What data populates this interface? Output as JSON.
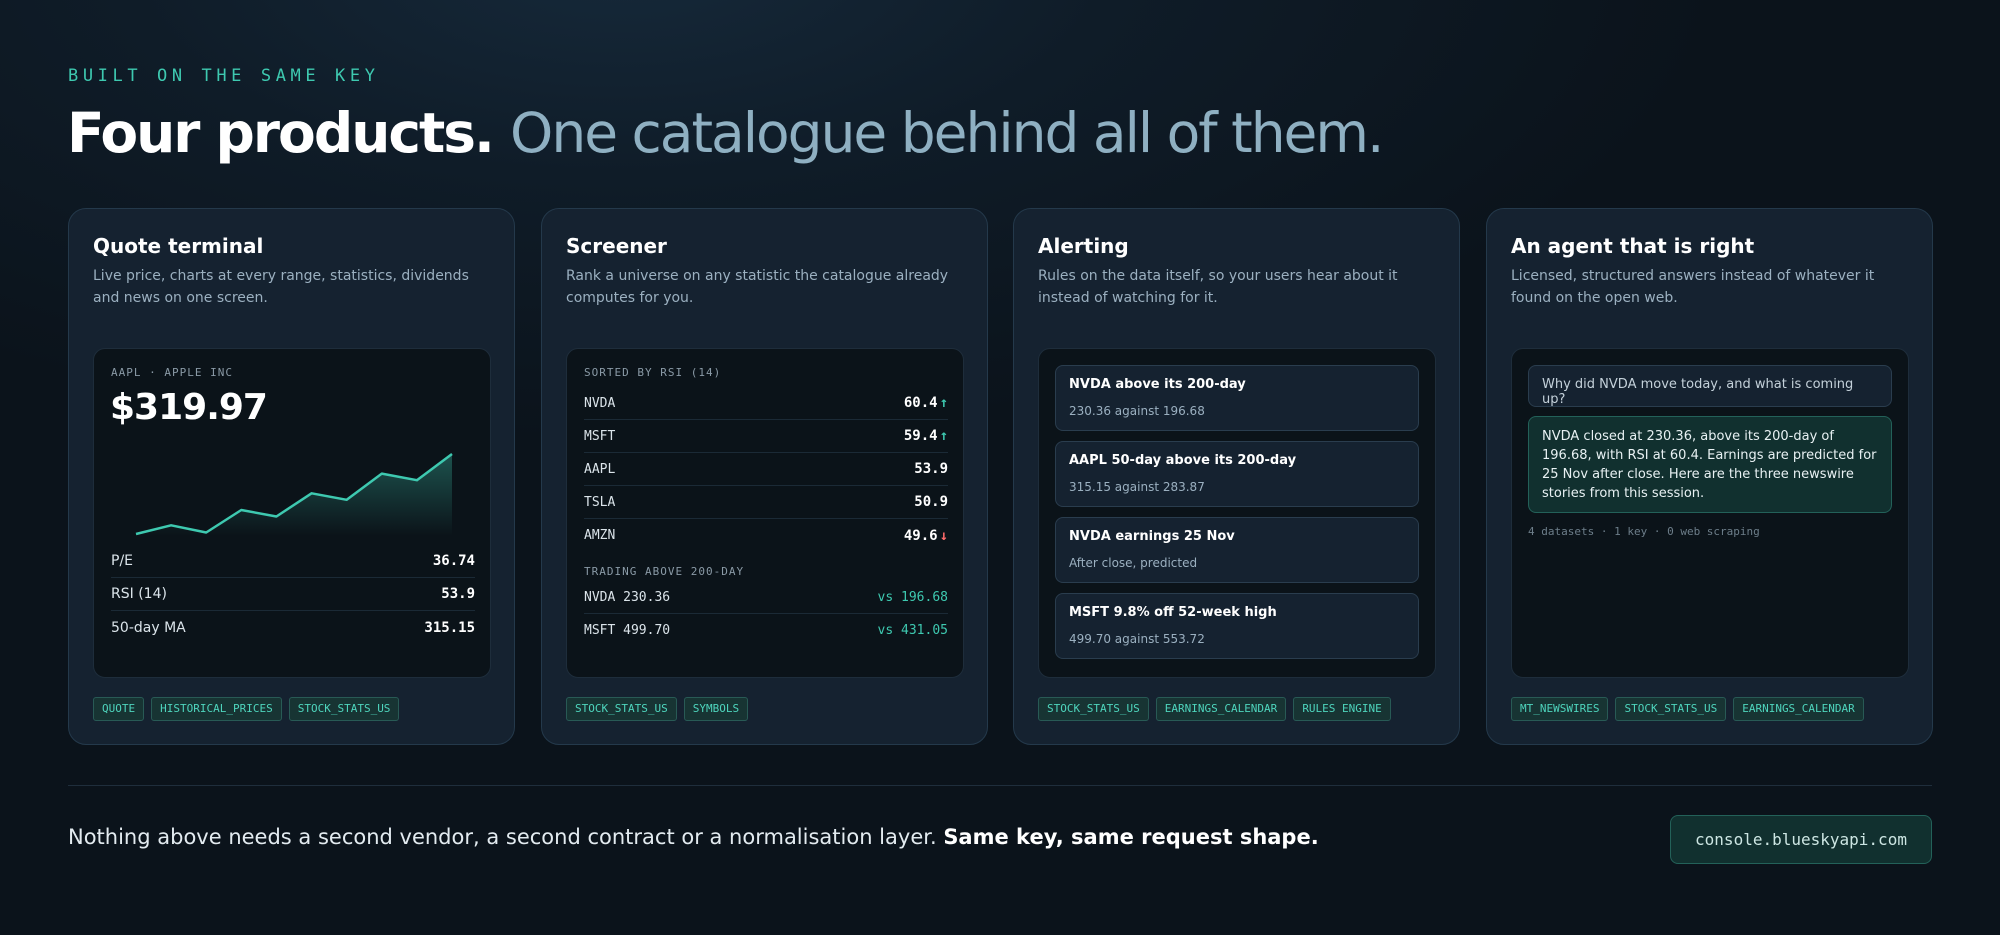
{
  "hero": {
    "eyebrow": "BUILT ON THE SAME KEY",
    "headline_strong": "Four products.",
    "headline_soft": "One catalogue behind all of them."
  },
  "colors": {
    "accent": "#3ec9b0",
    "negative": "#ff6b6b",
    "card_bg": "#152230",
    "page_bg": "#0b131b"
  },
  "cards": [
    {
      "title": "Quote terminal",
      "description": "Live price, charts at every range, statistics, dividends and news on one screen.",
      "tags": [
        "QUOTE",
        "HISTORICAL_PRICES",
        "STOCK_STATS_US"
      ]
    },
    {
      "title": "Screener",
      "description": "Rank a universe on any statistic the catalogue already computes for you.",
      "tags": [
        "STOCK_STATS_US",
        "SYMBOLS"
      ]
    },
    {
      "title": "Alerting",
      "description": "Rules on the data itself, so your users hear about it instead of watching for it.",
      "tags": [
        "STOCK_STATS_US",
        "EARNINGS_CALENDAR",
        "RULES ENGINE"
      ]
    },
    {
      "title": "An agent that is right",
      "description": "Licensed, structured answers instead of whatever it found on the open web.",
      "tags": [
        "MT_NEWSWIRES",
        "STOCK_STATS_US",
        "EARNINGS_CALENDAR"
      ]
    }
  ],
  "quote": {
    "symbol_line": "AAPL · APPLE INC",
    "price": "$319.97",
    "sparkline": [
      2,
      3.2,
      2.2,
      5.3,
      4.4,
      7.6,
      6.7,
      10.3,
      9.4,
      13
    ],
    "stats": [
      {
        "label": "P/E",
        "value": "36.74"
      },
      {
        "label": "RSI (14)",
        "value": "53.9"
      },
      {
        "label": "50-day MA",
        "value": "315.15"
      }
    ]
  },
  "screener": {
    "sort_heading": "SORTED BY RSI (14)",
    "rows": [
      {
        "symbol": "NVDA",
        "value": "60.4",
        "arrow": "↑"
      },
      {
        "symbol": "MSFT",
        "value": "59.4",
        "arrow": "↑"
      },
      {
        "symbol": "AAPL",
        "value": "53.9",
        "arrow": ""
      },
      {
        "symbol": "TSLA",
        "value": "50.9",
        "arrow": ""
      },
      {
        "symbol": "AMZN",
        "value": "49.6",
        "arrow": "↓"
      }
    ],
    "trend_heading": "TRADING ABOVE 200-DAY",
    "trend_rows": [
      {
        "left": "NVDA 230.36",
        "right": "vs 196.68"
      },
      {
        "left": "MSFT 499.70",
        "right": "vs 431.05"
      }
    ]
  },
  "alerts": [
    {
      "title": "NVDA above its 200-day",
      "detail": "230.36 against 196.68"
    },
    {
      "title": "AAPL 50-day above its 200-day",
      "detail": "315.15 against 283.87"
    },
    {
      "title": "NVDA earnings 25 Nov",
      "detail": "After close, predicted"
    },
    {
      "title": "MSFT 9.8% off 52-week high",
      "detail": "499.70 against 553.72"
    }
  ],
  "agent": {
    "question": "Why did NVDA move today, and what is coming up?",
    "answer": "NVDA closed at 230.36, above its 200-day of 196.68, with RSI at 60.4. Earnings are predicted for 25 Nov after close. Here are the three newswire stories from this session.",
    "meta": "4 datasets · 1 key · 0 web scraping"
  },
  "footer": {
    "text": "Nothing above needs a second vendor, a second contract or a normalisation layer.",
    "emphasis": "Same key, same request shape.",
    "console_link": "console.blueskyapi.com"
  }
}
